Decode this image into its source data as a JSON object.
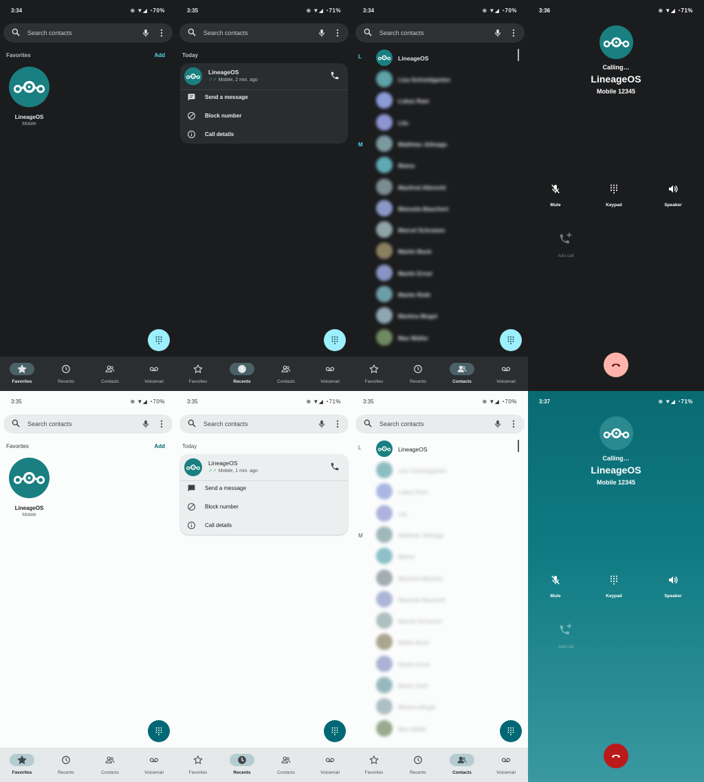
{
  "status_dark": [
    {
      "time": "3:34",
      "icons": "⊕ ▼◢ ◔70%"
    },
    {
      "time": "3:35",
      "icons": "⊕ ▼◢ ◔71%"
    },
    {
      "time": "3:34",
      "icons": "⊕ ▼◢ ◔70%"
    },
    {
      "time": "3:36",
      "icons": "⊕ ▼◢ ◔71%"
    }
  ],
  "status_light": [
    {
      "time": "3:35",
      "icons": "⊕ ▼◢ ◔70%"
    },
    {
      "time": "3:35",
      "icons": "⊕ ▼◢ ◔71%"
    },
    {
      "time": "3:35",
      "icons": "⊕ ▼◢ ◔70%"
    },
    {
      "time": "3:37",
      "icons": "⊕ ▼◢ ◔71%"
    }
  ],
  "search": {
    "placeholder": "Search contacts"
  },
  "favorites": {
    "section": "Favorites",
    "add": "Add",
    "name": "LineageOS",
    "sub": "Mobile"
  },
  "recents": {
    "section": "Today",
    "name": "LineageOS",
    "sub_dark": "Mobile, 2 min. ago",
    "sub_light": "Mobile, 1 min. ago",
    "arrows": "↗↗",
    "actions": [
      "Send a message",
      "Block number",
      "Call details"
    ]
  },
  "contacts": {
    "letters": [
      "L",
      "M"
    ],
    "first": "LineageOS",
    "blurred": [
      "Lisa Schmidgarten",
      "Lukas Ram",
      "Lilo",
      "Matthias Jeltsaga",
      "Mama",
      "Manfred Albrecht",
      "Manuela Bauchert",
      "Marcel Schramm",
      "Martin Buck",
      "Martin Ernst",
      "Martin Roth",
      "Martina Mogel",
      "Max Müller"
    ]
  },
  "nav": [
    "Favorites",
    "Recents",
    "Contacts",
    "Voicemail"
  ],
  "call": {
    "calling": "Calling…",
    "name": "LineageOS",
    "number": "Mobile 12345",
    "buttons": [
      "Mute",
      "Keypad",
      "Speaker"
    ],
    "add_call": "Add call"
  },
  "colors": {
    "accent_dark": "#4fd8eb",
    "accent_light": "#006874",
    "avatar": "#1a7f80",
    "end_call_dark": "#ffb4ab",
    "end_call_light": "#ba1a1a",
    "recent_arrow": "#3fae6f"
  },
  "icons": [
    "search-icon",
    "mic-icon",
    "more-icon",
    "dialpad-icon",
    "star-icon",
    "clock-icon",
    "people-icon",
    "voicemail-icon",
    "phone-icon",
    "message-icon",
    "block-icon",
    "info-icon",
    "mute-icon",
    "keypad-icon",
    "speaker-icon",
    "add-call-icon",
    "end-call-icon",
    "lineage-logo-icon"
  ]
}
